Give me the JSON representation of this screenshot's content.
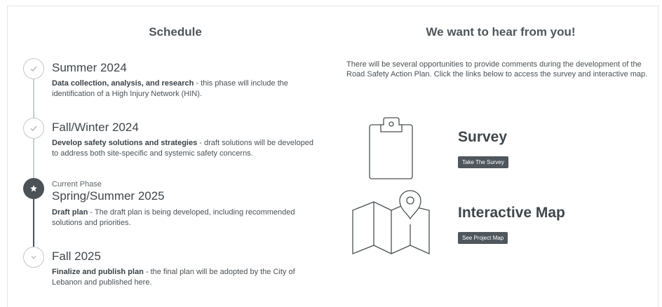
{
  "schedule": {
    "title": "Schedule",
    "phases": [
      {
        "title": "Summer 2024",
        "desc_bold": "Data collection, analysis, and research",
        "desc_rest": " - this phase will include the identification of a High Injury Network (HIN).",
        "status": "complete"
      },
      {
        "title": "Fall/Winter 2024",
        "desc_bold": "Develop safety solutions and strategies",
        "desc_rest": " - draft solutions will be developed to address both site-specific and systemic safety concerns.",
        "status": "complete"
      },
      {
        "label": "Current Phase",
        "title": "Spring/Summer 2025",
        "desc_bold": "Draft plan",
        "desc_rest": " - The draft plan is being developed, including recommended solutions and priorities.",
        "status": "current"
      },
      {
        "title": "Fall 2025",
        "desc_bold": "Finalize and publish plan",
        "desc_rest": " - the final plan will be adopted by the City of Lebanon and published here.",
        "status": "upcoming"
      }
    ]
  },
  "feedback": {
    "title": "We want to hear from you!",
    "intro": "There will be several opportunities to provide comments during the development of the Road Safety Action Plan. Click the links below to access the survey and interactive map.",
    "survey": {
      "title": "Survey",
      "button": "Take The Survey",
      "icon": "clipboard-icon"
    },
    "map": {
      "title": "Interactive Map",
      "button": "See Project Map",
      "icon": "map-pin-icon"
    }
  },
  "colors": {
    "accent_dark": "#4a5258",
    "timeline_complete": "#c3c8cc",
    "button_bg": "#4f575d"
  }
}
